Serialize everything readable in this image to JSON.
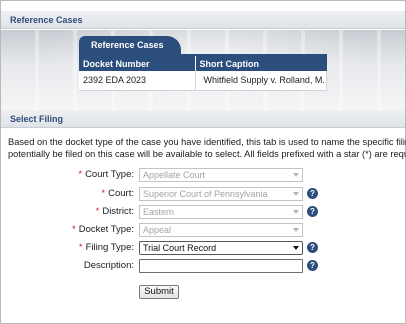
{
  "reference_cases": {
    "section_title": "Reference Cases",
    "tab_label": "Reference Cases",
    "columns": [
      "Docket Number",
      "Short Caption"
    ],
    "rows": [
      {
        "docket": "2392 EDA 2023",
        "caption": "Whitfield Supply v. Rolland, M."
      }
    ]
  },
  "select_filing": {
    "section_title": "Select Filing",
    "description_line1": "Based on the docket type of the case you have identified, this tab is used to name the specific filing",
    "description_line2": "potentially be filed on this case will be available to select. All fields prefixed with a star (*) are requir",
    "fields": {
      "court_type": {
        "label": "Court Type:",
        "value": "Appellate Court",
        "required": true,
        "enabled": false
      },
      "court": {
        "label": "Court:",
        "value": "Superior Court of Pennsylvania",
        "required": true,
        "enabled": false
      },
      "district": {
        "label": "District:",
        "value": "Eastern",
        "required": true,
        "enabled": false
      },
      "docket_type": {
        "label": "Docket Type:",
        "value": "Appeal",
        "required": true,
        "enabled": false
      },
      "filing_type": {
        "label": "Filing Type:",
        "value": "Trial Court Record",
        "required": true,
        "enabled": true
      },
      "description": {
        "label": "Description:",
        "value": "",
        "required": false,
        "enabled": true
      }
    },
    "star": "*",
    "help_glyph": "?",
    "submit_label": "Submit"
  },
  "colors": {
    "brand": "#2c4e7d",
    "required_star": "#d21f1f",
    "header_text": "#2f4e7b"
  }
}
